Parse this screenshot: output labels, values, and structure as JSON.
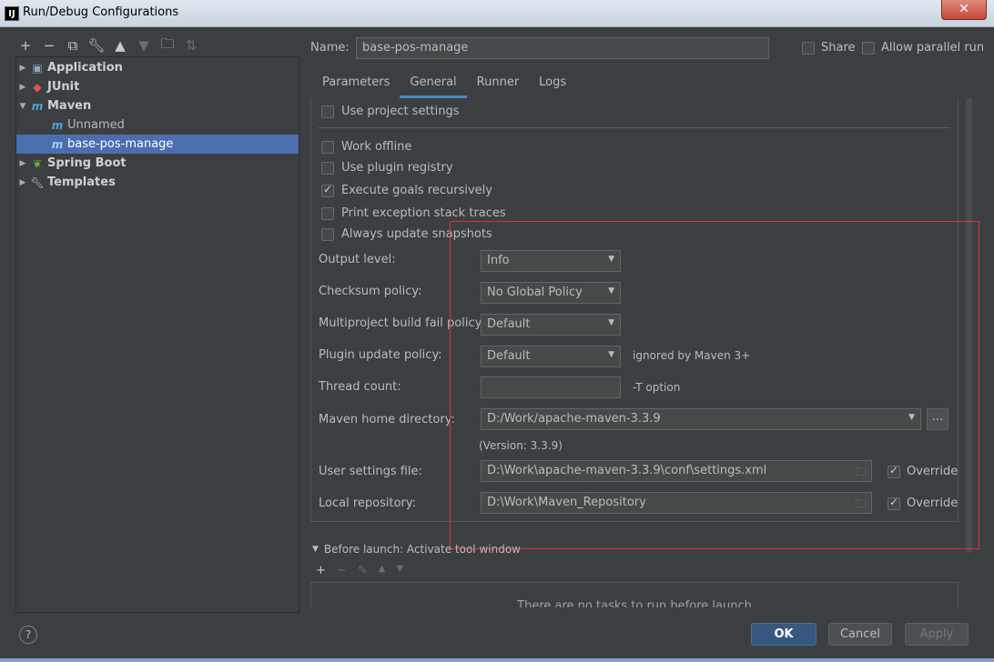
{
  "window": {
    "title": "Run/Debug Configurations",
    "app_icon": "intellij-icon",
    "close_label": "✕"
  },
  "toolbar": {
    "icons": [
      "add-icon",
      "remove-icon",
      "copy-icon",
      "wrench-icon",
      "move-up-icon",
      "move-down-icon",
      "folder-add-icon",
      "sort-icon"
    ]
  },
  "tree": {
    "items": [
      {
        "label": "Application",
        "icon": "application-icon",
        "level": 0,
        "expanded": false
      },
      {
        "label": "JUnit",
        "icon": "junit-icon",
        "level": 0,
        "expanded": false
      },
      {
        "label": "Maven",
        "icon": "maven-icon",
        "level": 0,
        "expanded": true
      },
      {
        "label": "Unnamed",
        "icon": "maven-icon",
        "level": 1
      },
      {
        "label": "base-pos-manage",
        "icon": "maven-icon",
        "level": 1,
        "selected": true
      },
      {
        "label": "Spring Boot",
        "icon": "spring-boot-icon",
        "level": 0,
        "expanded": false
      },
      {
        "label": "Templates",
        "icon": "wrench-icon",
        "level": 0,
        "expanded": false
      }
    ]
  },
  "header": {
    "name_label": "Name:",
    "name_value": "base-pos-manage",
    "share_label": "Share",
    "parallel_label": "Allow parallel run"
  },
  "tabs": [
    "Parameters",
    "General",
    "Runner",
    "Logs"
  ],
  "active_tab": "General",
  "general": {
    "use_project_settings": "Use project settings",
    "work_offline": "Work offline",
    "use_plugin_registry": "Use plugin registry",
    "execute_goals": "Execute goals recursively",
    "print_exception": "Print exception stack traces",
    "always_update": "Always update snapshots",
    "output_level_label": "Output level:",
    "output_level_value": "Info",
    "checksum_label": "Checksum policy:",
    "checksum_value": "No Global Policy",
    "multiproject_label": "Multiproject build fail policy:",
    "multiproject_value": "Default",
    "plugin_update_label": "Plugin update policy:",
    "plugin_update_value": "Default",
    "plugin_update_hint": "ignored by Maven 3+",
    "thread_count_label": "Thread count:",
    "thread_count_value": "",
    "thread_count_hint": "-T option",
    "maven_home_label": "Maven home directory:",
    "maven_home_value": "D:/Work/apache-maven-3.3.9",
    "version_text": "(Version: 3.3.9)",
    "user_settings_label": "User settings file:",
    "user_settings_value": "D:\\Work\\apache-maven-3.3.9\\conf\\settings.xml",
    "local_repo_label": "Local repository:",
    "local_repo_value": "D:\\Work\\Maven_Repository",
    "override_label": "Override",
    "browse_label": "..."
  },
  "before_launch": {
    "title": "Before launch: Activate tool window",
    "empty_text": "There are no tasks to run before launch"
  },
  "buttons": {
    "ok": "OK",
    "cancel": "Cancel",
    "apply": "Apply",
    "help": "?"
  },
  "colors": {
    "selection": "#4b6eaf",
    "primary_button": "#365880",
    "highlight_box": "#e0303a",
    "background": "#3c3f41"
  }
}
